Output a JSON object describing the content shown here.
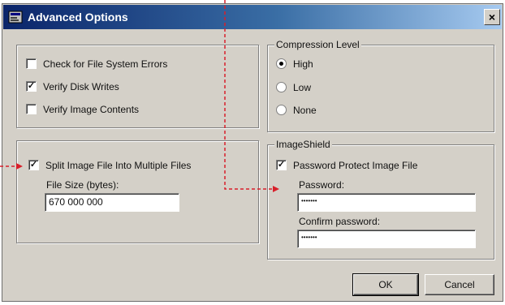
{
  "dialog": {
    "title": "Advanced Options",
    "close_symbol": "×"
  },
  "options": {
    "items": [
      {
        "label": "Check for File System Errors",
        "checked": false
      },
      {
        "label": "Verify Disk Writes",
        "checked": true
      },
      {
        "label": "Verify Image Contents",
        "checked": false
      }
    ]
  },
  "split": {
    "label": "Split Image File Into Multiple Files",
    "checked": true,
    "size_label": "File Size (bytes):",
    "size_value": "670 000 000"
  },
  "compression": {
    "legend": "Compression Level",
    "options": [
      {
        "label": "High",
        "selected": true
      },
      {
        "label": "Low",
        "selected": false
      },
      {
        "label": "None",
        "selected": false
      }
    ]
  },
  "imageshield": {
    "legend": "ImageShield",
    "protect_label": "Password Protect Image File",
    "protect_checked": true,
    "password_label": "Password:",
    "password_value": "•••••••",
    "confirm_label": "Confirm password:",
    "confirm_value": "•••••••"
  },
  "buttons": {
    "ok": "OK",
    "cancel": "Cancel"
  },
  "icons": {
    "check_glyph": "✓"
  },
  "colors": {
    "annotation_arrow": "#d81f2a",
    "dialog_face": "#d4d0c8",
    "title_start": "#0a246a"
  }
}
